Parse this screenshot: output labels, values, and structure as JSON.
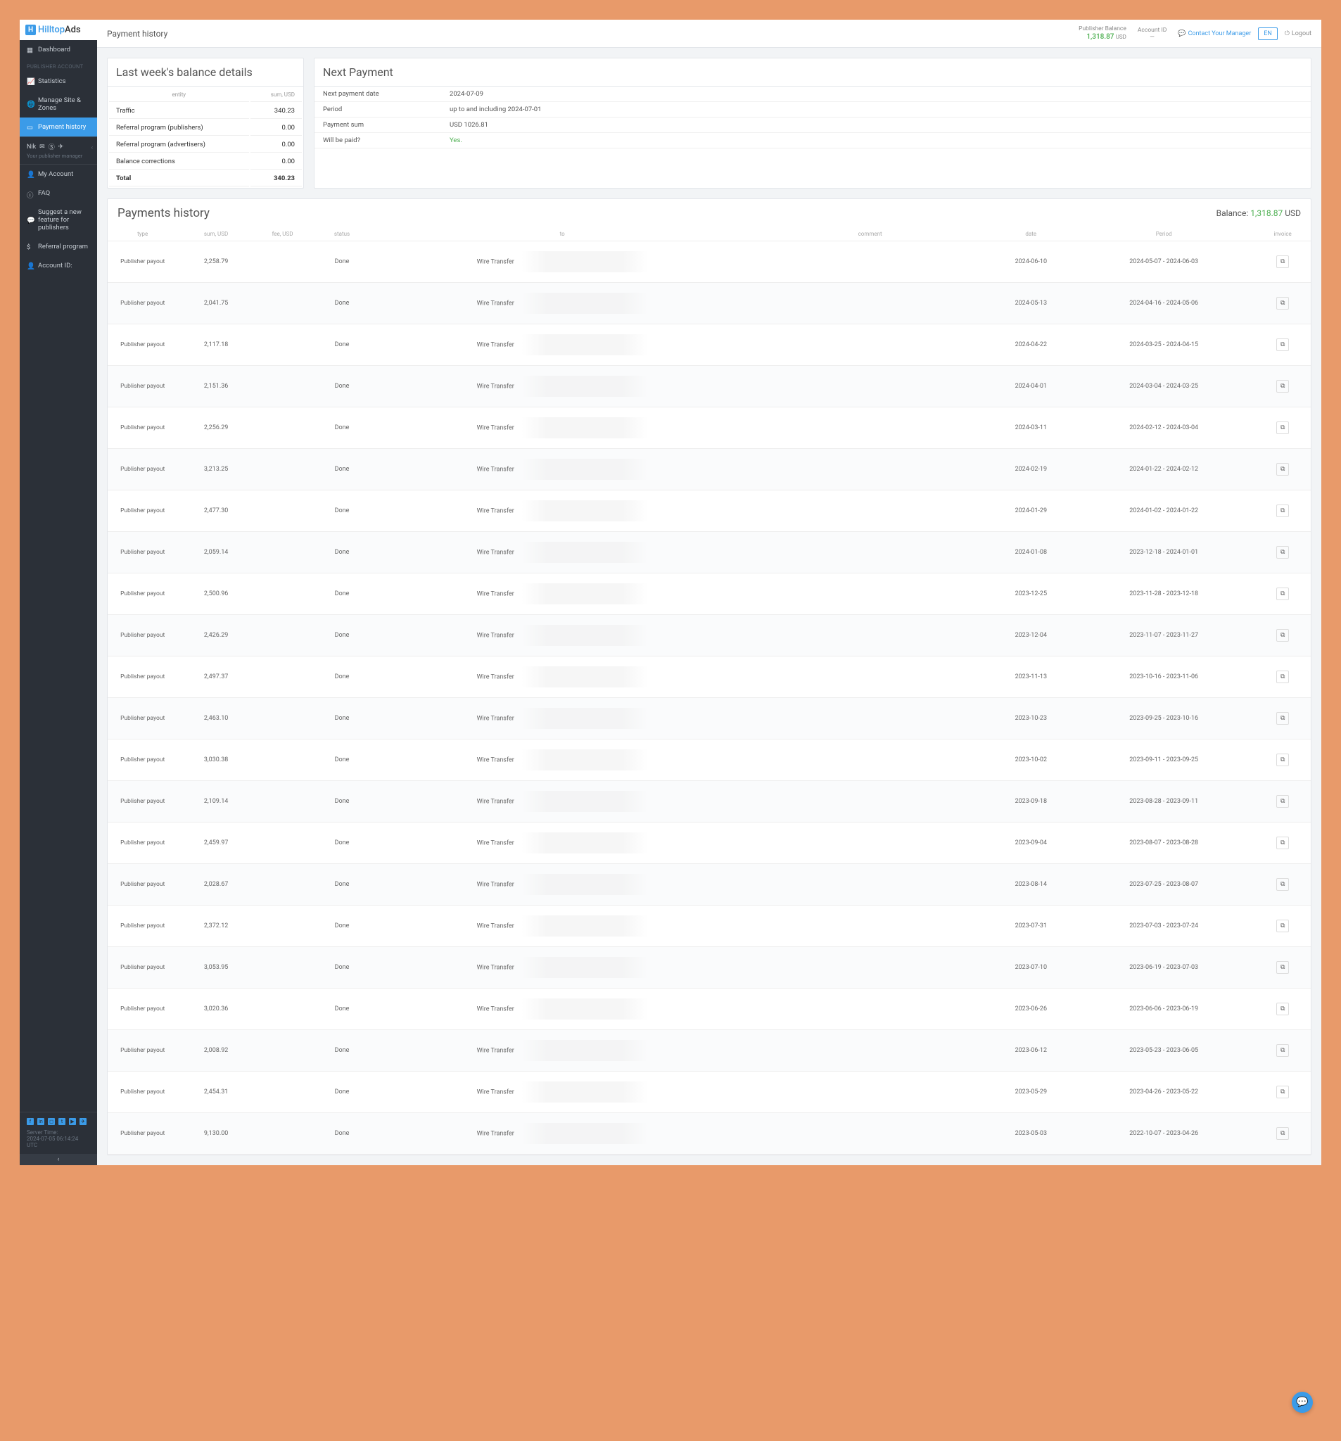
{
  "brand": {
    "name1": "Hilltop",
    "name2": "Ads"
  },
  "sidebar": {
    "section_label": "PUBLISHER ACCOUNT",
    "items": {
      "dashboard": "Dashboard",
      "statistics": "Statistics",
      "manage": "Manage Site & Zones",
      "payment": "Payment history",
      "account": "My Account",
      "faq": "FAQ",
      "suggest": "Suggest a new feature for publishers",
      "referral": "Referral program",
      "account_id": "Account ID:"
    },
    "user": {
      "name": "Nik",
      "sub": "Your publisher manager"
    },
    "server_time_label": "Server Time:",
    "server_time": "2024-07-05 06:14:24 UTC"
  },
  "topbar": {
    "title": "Payment history",
    "balance_label": "Publisher Balance",
    "balance_value": "1,318.87",
    "balance_cur": "USD",
    "account_id_label": "Account ID",
    "manager": "Contact Your Manager",
    "lang": "EN",
    "logout": "Logout"
  },
  "last_week": {
    "title": "Last week's balance details",
    "col1": "entity",
    "col2": "sum, USD",
    "rows": [
      {
        "label": "Traffic",
        "value": "340.23"
      },
      {
        "label": "Referral program (publishers)",
        "value": "0.00"
      },
      {
        "label": "Referral program (advertisers)",
        "value": "0.00"
      },
      {
        "label": "Balance corrections",
        "value": "0.00"
      }
    ],
    "total_label": "Total",
    "total_value": "340.23"
  },
  "next_payment": {
    "title": "Next Payment",
    "rows": [
      {
        "label": "Next payment date",
        "value": "2024-07-09"
      },
      {
        "label": "Period",
        "value": "up to and including 2024-07-01"
      },
      {
        "label": "Payment sum",
        "value": "USD 1026.81"
      },
      {
        "label": "Will be paid?",
        "value": "Yes.",
        "yes": true
      }
    ]
  },
  "history": {
    "title": "Payments history",
    "balance_label": "Balance:",
    "balance_value": "1,318.87",
    "balance_cur": "USD",
    "columns": {
      "type": "type",
      "sum": "sum, USD",
      "fee": "fee, USD",
      "status": "status",
      "to": "to",
      "comment": "comment",
      "date": "date",
      "period": "Period",
      "invoice": "invoice"
    },
    "type_label": "Publisher payout",
    "status_label": "Done",
    "to_label": "Wire Transfer",
    "rows": [
      {
        "sum": "2,258.79",
        "date": "2024-06-10",
        "period": "2024-05-07 - 2024-06-03"
      },
      {
        "sum": "2,041.75",
        "date": "2024-05-13",
        "period": "2024-04-16 - 2024-05-06"
      },
      {
        "sum": "2,117.18",
        "date": "2024-04-22",
        "period": "2024-03-25 - 2024-04-15"
      },
      {
        "sum": "2,151.36",
        "date": "2024-04-01",
        "period": "2024-03-04 - 2024-03-25"
      },
      {
        "sum": "2,256.29",
        "date": "2024-03-11",
        "period": "2024-02-12 - 2024-03-04"
      },
      {
        "sum": "3,213.25",
        "date": "2024-02-19",
        "period": "2024-01-22 - 2024-02-12"
      },
      {
        "sum": "2,477.30",
        "date": "2024-01-29",
        "period": "2024-01-02 - 2024-01-22"
      },
      {
        "sum": "2,059.14",
        "date": "2024-01-08",
        "period": "2023-12-18 - 2024-01-01"
      },
      {
        "sum": "2,500.96",
        "date": "2023-12-25",
        "period": "2023-11-28 - 2023-12-18"
      },
      {
        "sum": "2,426.29",
        "date": "2023-12-04",
        "period": "2023-11-07 - 2023-11-27"
      },
      {
        "sum": "2,497.37",
        "date": "2023-11-13",
        "period": "2023-10-16 - 2023-11-06"
      },
      {
        "sum": "2,463.10",
        "date": "2023-10-23",
        "period": "2023-09-25 - 2023-10-16"
      },
      {
        "sum": "3,030.38",
        "date": "2023-10-02",
        "period": "2023-09-11 - 2023-09-25"
      },
      {
        "sum": "2,109.14",
        "date": "2023-09-18",
        "period": "2023-08-28 - 2023-09-11"
      },
      {
        "sum": "2,459.97",
        "date": "2023-09-04",
        "period": "2023-08-07 - 2023-08-28"
      },
      {
        "sum": "2,028.67",
        "date": "2023-08-14",
        "period": "2023-07-25 - 2023-08-07"
      },
      {
        "sum": "2,372.12",
        "date": "2023-07-31",
        "period": "2023-07-03 - 2023-07-24"
      },
      {
        "sum": "3,053.95",
        "date": "2023-07-10",
        "period": "2023-06-19 - 2023-07-03"
      },
      {
        "sum": "3,020.36",
        "date": "2023-06-26",
        "period": "2023-06-06 - 2023-06-19"
      },
      {
        "sum": "2,008.92",
        "date": "2023-06-12",
        "period": "2023-05-23 - 2023-06-05"
      },
      {
        "sum": "2,454.31",
        "date": "2023-05-29",
        "period": "2023-04-26 - 2023-05-22"
      },
      {
        "sum": "9,130.00",
        "date": "2023-05-03",
        "period": "2022-10-07 - 2023-04-26"
      }
    ]
  }
}
